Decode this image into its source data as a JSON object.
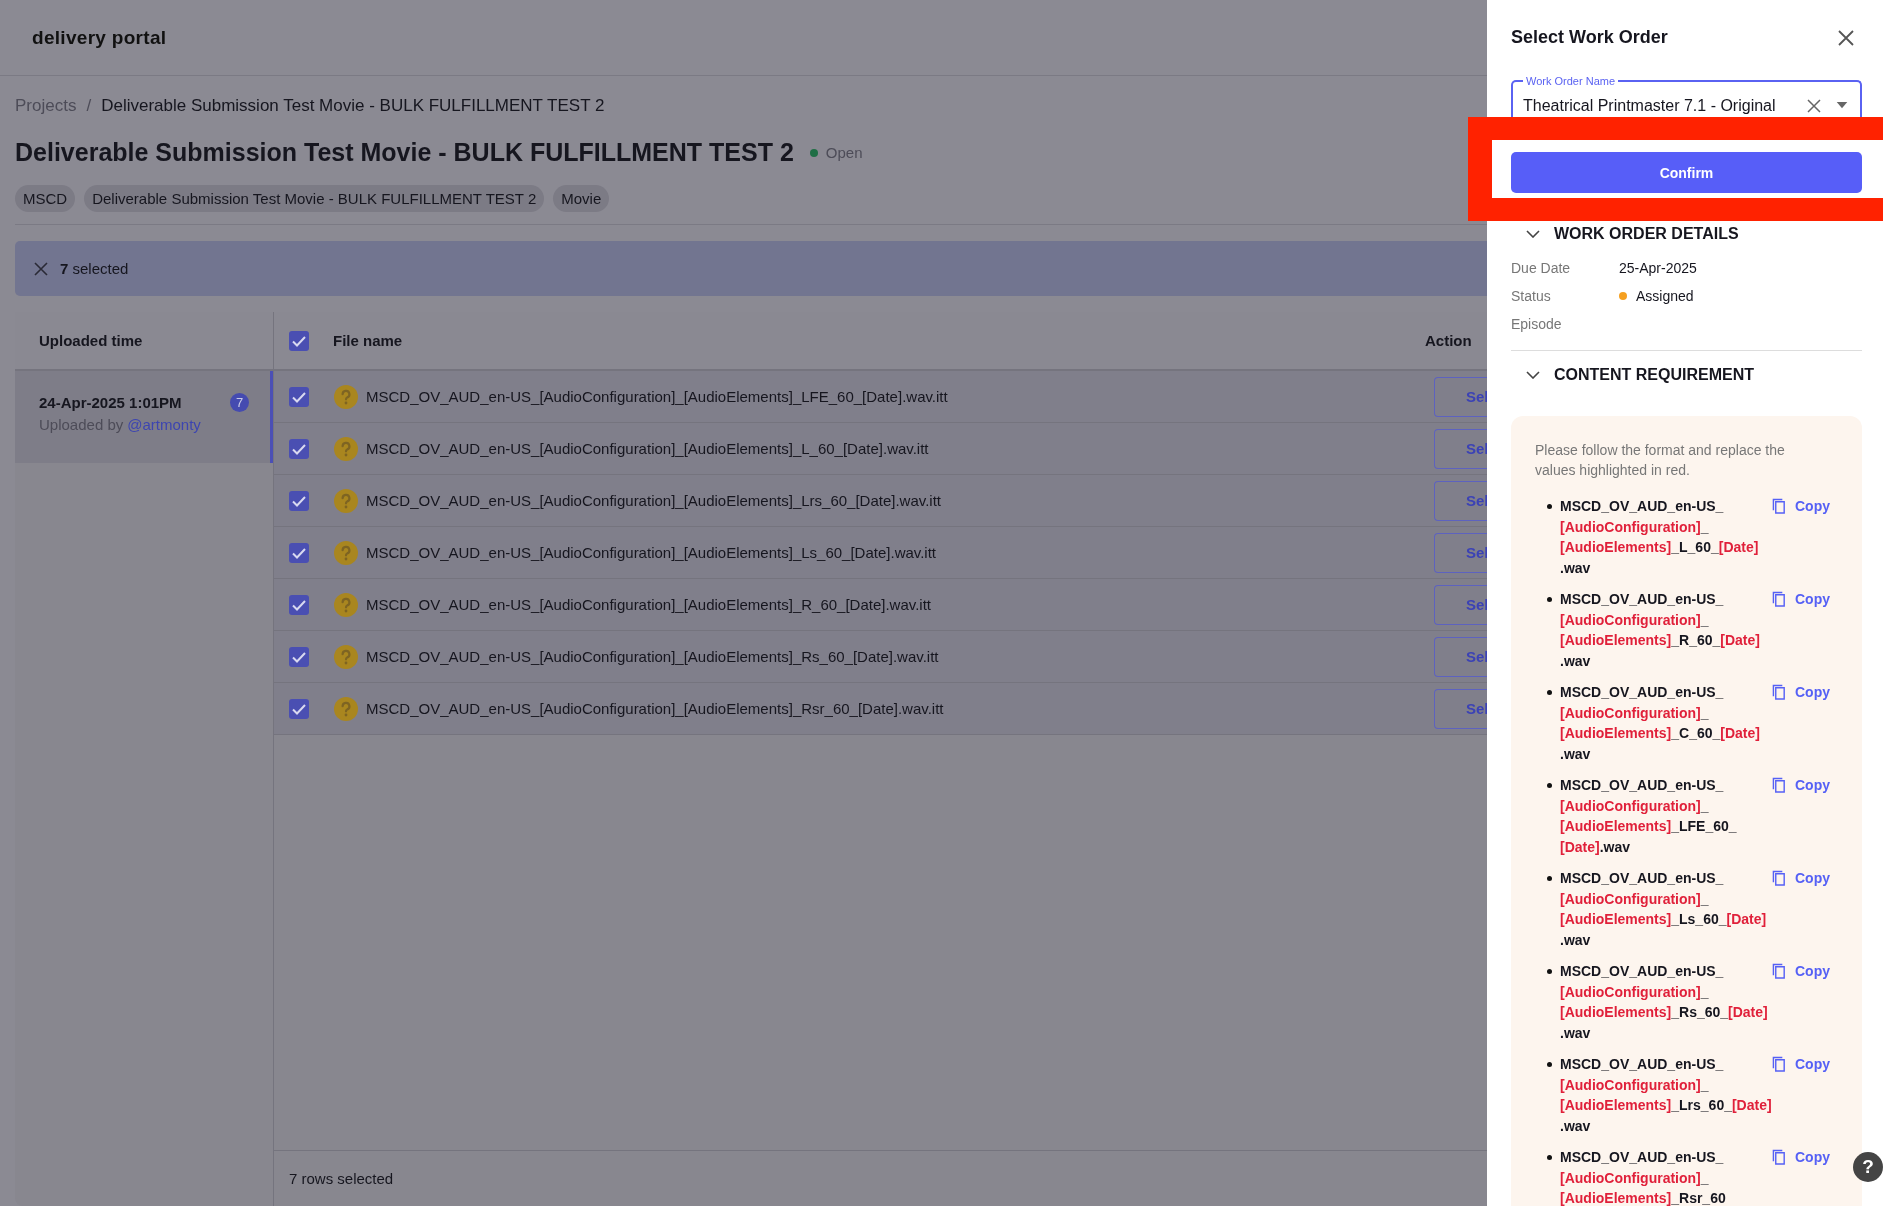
{
  "header": {
    "logo": "delivery portal"
  },
  "breadcrumb": {
    "items": [
      "Projects",
      "Deliverable Submission Test Movie - BULK FULFILLMENT TEST 2"
    ],
    "separator": "/"
  },
  "project": {
    "title": "Deliverable Submission Test Movie - BULK FULFILLMENT TEST 2",
    "status": "Open"
  },
  "tags": [
    "MSCD",
    "Deliverable Submission Test Movie - BULK FULFILLMENT TEST 2",
    "Movie"
  ],
  "selection_bar": {
    "label": "**7** selected"
  },
  "table": {
    "columns": [
      "Uploaded time",
      "File name",
      "Action"
    ],
    "header_checked": true,
    "group": {
      "time": "24-Apr-2025 1:01PM",
      "count": "7",
      "uploaded_by": "Uploaded by",
      "user": "@artmonty",
      "selected": true
    },
    "rows": [
      {
        "checked": true,
        "file": "MSCD_OV_AUD_en-US_[AudioConfiguration]_[AudioElements]_LFE_60_[Date].wav.itt",
        "action": "Sel"
      },
      {
        "checked": true,
        "file": "MSCD_OV_AUD_en-US_[AudioConfiguration]_[AudioElements]_L_60_[Date].wav.itt",
        "action": "Sel"
      },
      {
        "checked": true,
        "file": "MSCD_OV_AUD_en-US_[AudioConfiguration]_[AudioElements]_Lrs_60_[Date].wav.itt",
        "action": "Sel"
      },
      {
        "checked": true,
        "file": "MSCD_OV_AUD_en-US_[AudioConfiguration]_[AudioElements]_Ls_60_[Date].wav.itt",
        "action": "Sel"
      },
      {
        "checked": true,
        "file": "MSCD_OV_AUD_en-US_[AudioConfiguration]_[AudioElements]_R_60_[Date].wav.itt",
        "action": "Sel"
      },
      {
        "checked": true,
        "file": "MSCD_OV_AUD_en-US_[AudioConfiguration]_[AudioElements]_Rs_60_[Date].wav.itt",
        "action": "Sel"
      },
      {
        "checked": true,
        "file": "MSCD_OV_AUD_en-US_[AudioConfiguration]_[AudioElements]_Rsr_60_[Date].wav.itt",
        "action": "Sel"
      }
    ],
    "footer": "7 rows selected"
  },
  "panel": {
    "title": "Select Work Order",
    "field": {
      "label": "Work Order Name",
      "value": "Theatrical Printmaster 7.1 - Original"
    },
    "confirm": "Confirm",
    "highlight_confirm": true,
    "details": {
      "heading": "WORK ORDER DETAILS",
      "expanded": true,
      "fields": [
        {
          "label": "Due Date",
          "value": "25-Apr-2025",
          "kind": "text"
        },
        {
          "label": "Status",
          "value": "Assigned",
          "kind": "status"
        },
        {
          "label": "Episode"
        }
      ]
    },
    "requirement": {
      "heading": "CONTENT REQUIREMENT",
      "expanded": true,
      "intro": "Please follow the format and replace the values highlighted in red.",
      "items": [
        {
          "copy": "Copy",
          "segments": [
            {
              "text": "MSCD_OV_AUD_en-US_",
              "highlighted": false
            },
            {
              "text": "[AudioConfiguration]",
              "highlighted": true
            },
            {
              "text": "_",
              "highlighted": false
            },
            {
              "text": "[AudioElements]",
              "highlighted": true
            },
            {
              "text": "_L_60_",
              "highlighted": false
            },
            {
              "text": "[Date]",
              "highlighted": true
            },
            {
              "text": ".wav",
              "highlighted": false
            }
          ]
        },
        {
          "copy": "Copy",
          "segments": [
            {
              "text": "MSCD_OV_AUD_en-US_",
              "highlighted": false
            },
            {
              "text": "[AudioConfiguration]",
              "highlighted": true
            },
            {
              "text": "_",
              "highlighted": false
            },
            {
              "text": "[AudioElements]",
              "highlighted": true
            },
            {
              "text": "_R_60_",
              "highlighted": false
            },
            {
              "text": "[Date]",
              "highlighted": true
            },
            {
              "text": ".wav",
              "highlighted": false
            }
          ]
        },
        {
          "copy": "Copy",
          "segments": [
            {
              "text": "MSCD_OV_AUD_en-US_",
              "highlighted": false
            },
            {
              "text": "[AudioConfiguration]",
              "highlighted": true
            },
            {
              "text": "_",
              "highlighted": false
            },
            {
              "text": "[AudioElements]",
              "highlighted": true
            },
            {
              "text": "_C_60_",
              "highlighted": false
            },
            {
              "text": "[Date]",
              "highlighted": true
            },
            {
              "text": ".wav",
              "highlighted": false
            }
          ]
        },
        {
          "copy": "Copy",
          "segments": [
            {
              "text": "MSCD_OV_AUD_en-US_",
              "highlighted": false
            },
            {
              "text": "[AudioConfiguration]",
              "highlighted": true
            },
            {
              "text": "_",
              "highlighted": false
            },
            {
              "text": "[AudioElements]",
              "highlighted": true
            },
            {
              "text": "_LFE_60_",
              "highlighted": false
            },
            {
              "text": "[Date]",
              "highlighted": true
            },
            {
              "text": ".wav",
              "highlighted": false
            }
          ]
        },
        {
          "copy": "Copy",
          "segments": [
            {
              "text": "MSCD_OV_AUD_en-US_",
              "highlighted": false
            },
            {
              "text": "[AudioConfiguration]",
              "highlighted": true
            },
            {
              "text": "_",
              "highlighted": false
            },
            {
              "text": "[AudioElements]",
              "highlighted": true
            },
            {
              "text": "_Ls_60_",
              "highlighted": false
            },
            {
              "text": "[Date]",
              "highlighted": true
            },
            {
              "text": ".wav",
              "highlighted": false
            }
          ]
        },
        {
          "copy": "Copy",
          "segments": [
            {
              "text": "MSCD_OV_AUD_en-US_",
              "highlighted": false
            },
            {
              "text": "[AudioConfiguration]",
              "highlighted": true
            },
            {
              "text": "_",
              "highlighted": false
            },
            {
              "text": "[AudioElements]",
              "highlighted": true
            },
            {
              "text": "_Rs_60_",
              "highlighted": false
            },
            {
              "text": "[Date]",
              "highlighted": true
            },
            {
              "text": ".wav",
              "highlighted": false
            }
          ]
        },
        {
          "copy": "Copy",
          "segments": [
            {
              "text": "MSCD_OV_AUD_en-US_",
              "highlighted": false
            },
            {
              "text": "[AudioConfiguration]",
              "highlighted": true
            },
            {
              "text": "_",
              "highlighted": false
            },
            {
              "text": "[AudioElements]",
              "highlighted": true
            },
            {
              "text": "_Lrs_60_",
              "highlighted": false
            },
            {
              "text": "[Date]",
              "highlighted": true
            },
            {
              "text": ".wav",
              "highlighted": false
            }
          ]
        },
        {
          "copy": "Copy",
          "segments": [
            {
              "text": "MSCD_OV_AUD_en-US_",
              "highlighted": false
            },
            {
              "text": "[AudioConfiguration]",
              "highlighted": true
            },
            {
              "text": "_",
              "highlighted": false
            },
            {
              "text": "[AudioElements]",
              "highlighted": true
            },
            {
              "text": "_Rsr_60",
              "highlighted": false
            }
          ]
        }
      ]
    }
  },
  "help_button": "?"
}
